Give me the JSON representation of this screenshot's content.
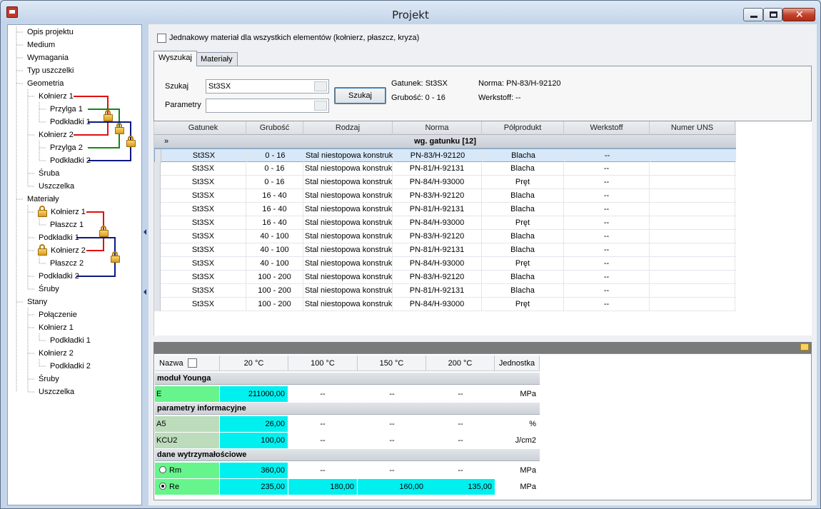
{
  "window": {
    "title": "Projekt"
  },
  "tree": [
    {
      "label": "Opis projektu",
      "level": 0
    },
    {
      "label": "Medium",
      "level": 0
    },
    {
      "label": "Wymagania",
      "level": 0
    },
    {
      "label": "Typ uszczelki",
      "level": 0
    },
    {
      "label": "Geometria",
      "level": 0
    },
    {
      "label": "Kołnierz 1",
      "level": 1
    },
    {
      "label": "Przylga 1",
      "level": 2
    },
    {
      "label": "Podkładki 1",
      "level": 2
    },
    {
      "label": "Kołnierz 2",
      "level": 1
    },
    {
      "label": "Przylga 2",
      "level": 2
    },
    {
      "label": "Podkładki 2",
      "level": 2
    },
    {
      "label": "Śruba",
      "level": 1
    },
    {
      "label": "Uszczelka",
      "level": 1
    },
    {
      "label": "Materiały",
      "level": 0
    },
    {
      "label": "Kołnierz 1",
      "level": 1,
      "lock": true
    },
    {
      "label": "Płaszcz 1",
      "level": 2
    },
    {
      "label": "Podkładki 1",
      "level": 1
    },
    {
      "label": "Kołnierz 2",
      "level": 1,
      "lock": true
    },
    {
      "label": "Płaszcz 2",
      "level": 2
    },
    {
      "label": "Podkładki 2",
      "level": 1
    },
    {
      "label": "Śruby",
      "level": 1
    },
    {
      "label": "Stany",
      "level": 0
    },
    {
      "label": "Połączenie",
      "level": 1
    },
    {
      "label": "Kołnierz 1",
      "level": 1
    },
    {
      "label": "Podkładki 1",
      "level": 2
    },
    {
      "label": "Kołnierz 2",
      "level": 1
    },
    {
      "label": "Podkładki 2",
      "level": 2
    },
    {
      "label": "Śruby",
      "level": 1
    },
    {
      "label": "Uszczelka",
      "level": 1
    }
  ],
  "link_colors": {
    "red": "#e01010",
    "green": "#128a12",
    "blue": "#0a1a80"
  },
  "same_material_label": "Jednakowy materiał dla wszystkich elementów (kołnierz, płaszcz, kryza)",
  "tabs": [
    {
      "label": "Wyszukaj",
      "active": true
    },
    {
      "label": "Materiały",
      "active": false
    }
  ],
  "search": {
    "szukaj_label": "Szukaj",
    "szukaj_value": "St3SX",
    "parametry_label": "Parametry",
    "parametry_value": "",
    "button_label": "Szukaj",
    "gatunek": "Gatunek: St3SX",
    "grubosc": "Grubość: 0 - 16",
    "norma": "Norma: PN-83/H-92120",
    "werkstoff": "Werkstoff: --"
  },
  "results": {
    "columns": [
      "Gatunek",
      "Grubość",
      "Rodzaj",
      "Norma",
      "Półprodukt",
      "Werkstoff",
      "Numer UNS"
    ],
    "group_label": "wg. gatunku [12]",
    "expand_glyph": "»",
    "rows": [
      [
        "St3SX",
        "0 - 16",
        "Stal niestopowa konstrukcyjna",
        "PN-83/H-92120",
        "Blacha",
        "--",
        ""
      ],
      [
        "St3SX",
        "0 - 16",
        "Stal niestopowa konstrukcyjna",
        "PN-81/H-92131",
        "Blacha",
        "--",
        ""
      ],
      [
        "St3SX",
        "0 - 16",
        "Stal niestopowa konstrukcyjna",
        "PN-84/H-93000",
        "Pręt",
        "--",
        ""
      ],
      [
        "St3SX",
        "16 - 40",
        "Stal niestopowa konstrukcyjna",
        "PN-83/H-92120",
        "Blacha",
        "--",
        ""
      ],
      [
        "St3SX",
        "16 - 40",
        "Stal niestopowa konstrukcyjna",
        "PN-81/H-92131",
        "Blacha",
        "--",
        ""
      ],
      [
        "St3SX",
        "16 - 40",
        "Stal niestopowa konstrukcyjna",
        "PN-84/H-93000",
        "Pręt",
        "--",
        ""
      ],
      [
        "St3SX",
        "40 - 100",
        "Stal niestopowa konstrukcyjna",
        "PN-83/H-92120",
        "Blacha",
        "--",
        ""
      ],
      [
        "St3SX",
        "40 - 100",
        "Stal niestopowa konstrukcyjna",
        "PN-81/H-92131",
        "Blacha",
        "--",
        ""
      ],
      [
        "St3SX",
        "40 - 100",
        "Stal niestopowa konstrukcyjna",
        "PN-84/H-93000",
        "Pręt",
        "--",
        ""
      ],
      [
        "St3SX",
        "100 - 200",
        "Stal niestopowa konstrukcyjna",
        "PN-83/H-92120",
        "Blacha",
        "--",
        ""
      ],
      [
        "St3SX",
        "100 - 200",
        "Stal niestopowa konstrukcyjna",
        "PN-81/H-92131",
        "Blacha",
        "--",
        ""
      ],
      [
        "St3SX",
        "100 - 200",
        "Stal niestopowa konstrukcyjna",
        "PN-84/H-93000",
        "Pręt",
        "--",
        ""
      ]
    ],
    "selected_row": 0
  },
  "properties": {
    "headers": [
      "Nazwa",
      "20 °C",
      "100 °C",
      "150 °C",
      "200 °C",
      "Jednostka"
    ],
    "sections": [
      {
        "title": "moduł Younga",
        "rows": [
          {
            "name": "E",
            "v20": "211000,00",
            "v100": "--",
            "v150": "--",
            "v200": "--",
            "unit": "MPa"
          }
        ]
      },
      {
        "title": "parametry informacyjne",
        "rows": [
          {
            "name": "A5",
            "v20": "26,00",
            "v100": "--",
            "v150": "--",
            "v200": "--",
            "unit": "%"
          },
          {
            "name": "KCU2",
            "v20": "100,00",
            "v100": "--",
            "v150": "--",
            "v200": "--",
            "unit": "J/cm2"
          }
        ]
      },
      {
        "title": "dane wytrzymałościowe",
        "rows": [
          {
            "name": "Rm",
            "radio": true,
            "checked": false,
            "v20": "360,00",
            "v100": "--",
            "v150": "--",
            "v200": "--",
            "unit": "MPa"
          },
          {
            "name": "Re",
            "radio": true,
            "checked": true,
            "v20": "235,00",
            "v100": "180,00",
            "v150": "160,00",
            "v200": "135,00",
            "unit": "MPa"
          }
        ]
      }
    ],
    "colors": {
      "name_green": "#bcdcbc",
      "name_green_bright": "#66f58c",
      "value_cyan": "#00f0f0"
    }
  }
}
